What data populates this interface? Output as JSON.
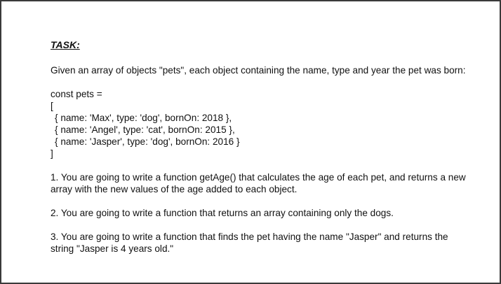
{
  "task": {
    "heading": "TASK:",
    "intro": "Given an array of objects \"pets\", each object containing the name, type and year the pet was born:",
    "code": {
      "declaration": "const pets =",
      "open": "[",
      "items": [
        "{ name: 'Max', type: 'dog', bornOn: 2018 },",
        "{ name: 'Angel', type: 'cat', bornOn: 2015 },",
        "{ name: 'Jasper', type: 'dog', bornOn: 2016 }"
      ],
      "close": "]"
    },
    "steps": [
      "1. You are going to write a function getAge() that calculates the age of each pet, and returns a new array with the new values of the age added to each object.",
      "2. You are going to write a function that returns an array containing only the dogs.",
      "3. You are going to write a function that finds the pet having the name \"Jasper\" and returns the string \"Jasper is 4 years old.\""
    ]
  }
}
